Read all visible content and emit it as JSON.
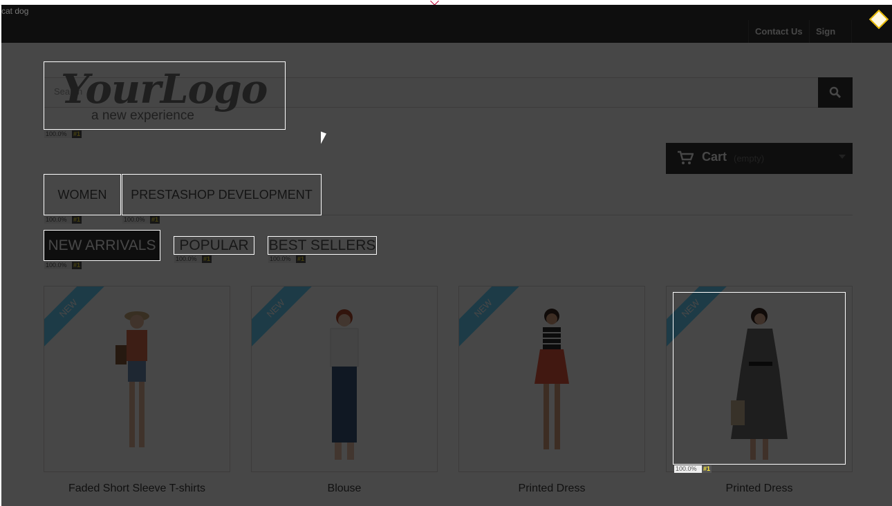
{
  "corner_label": "cat dog",
  "header": {
    "contact_label": "Contact Us",
    "signin_label": "Sign in"
  },
  "search": {
    "placeholder": "Search"
  },
  "logo": {
    "main": "YourLogo",
    "tagline": "a new experience"
  },
  "cart": {
    "label": "Cart",
    "status": "(empty)"
  },
  "menu": {
    "items": [
      {
        "label": "WOMEN"
      },
      {
        "label": "PRESTASHOP DEVELOPMENT"
      }
    ]
  },
  "tabs": [
    {
      "label": "NEW ARRIVALS",
      "active": true
    },
    {
      "label": "POPULAR",
      "active": false
    },
    {
      "label": "BEST SELLERS",
      "active": false
    }
  ],
  "badges": {
    "pct": "100.0%",
    "num": "#1"
  },
  "products": [
    {
      "name": "Faded Short Sleeve T-shirts",
      "ribbon": "NEW"
    },
    {
      "name": "Blouse",
      "ribbon": "NEW"
    },
    {
      "name": "Printed Dress",
      "ribbon": "NEW"
    },
    {
      "name": "Printed Dress",
      "ribbon": "NEW"
    }
  ],
  "colors": {
    "overlay": "#000000",
    "highlight": "#ffffff",
    "ribbon": "#6ad4ff",
    "badge_num": "#ffeb3b"
  }
}
